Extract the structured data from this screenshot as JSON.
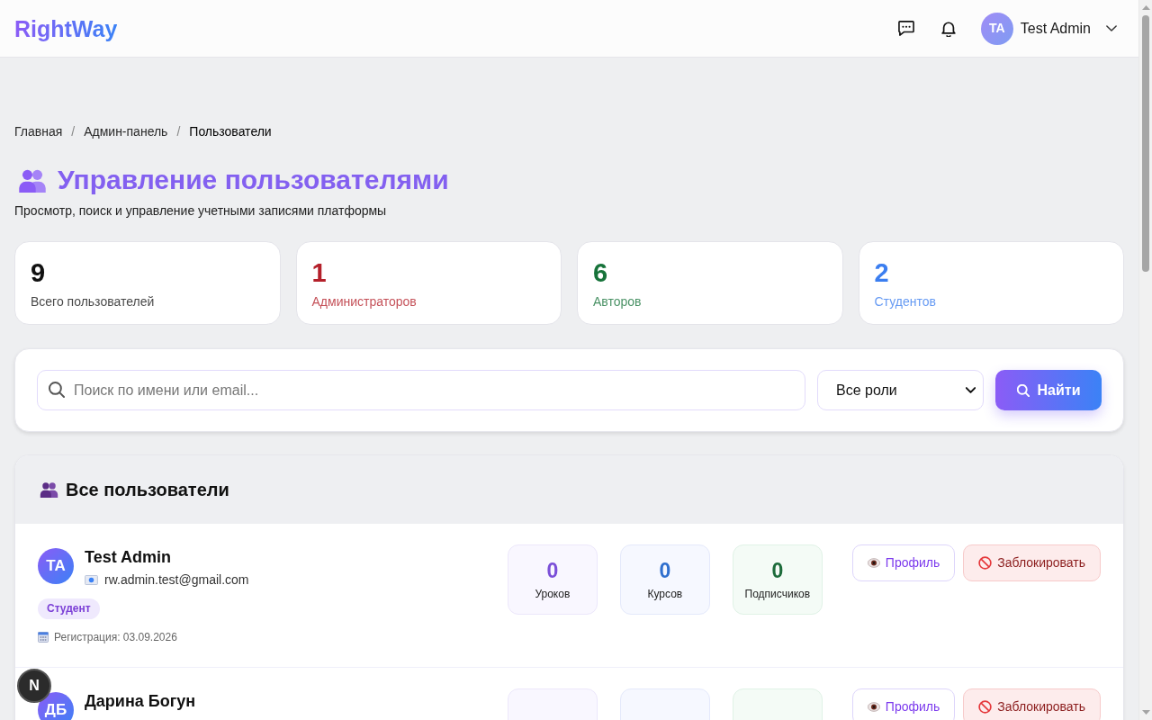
{
  "navbar": {
    "logo": "RightWay",
    "user": {
      "initials": "TA",
      "name": "Test Admin"
    }
  },
  "breadcrumb": [
    {
      "kind": "link",
      "text": "Главная"
    },
    {
      "kind": "separator",
      "text": "/"
    },
    {
      "kind": "link",
      "text": "Админ-панель"
    },
    {
      "kind": "separator",
      "text": "/"
    },
    {
      "kind": "current",
      "text": "Пользователи"
    }
  ],
  "header": {
    "title": "Управление пользователями",
    "subtitle": "Просмотр, поиск и управление учетными записями платформы"
  },
  "stats": [
    {
      "value": "9",
      "label": "Всего пользователей",
      "color": "#111111"
    },
    {
      "value": "1",
      "label": "Администраторов",
      "color": "#b4202a"
    },
    {
      "value": "6",
      "label": "Авторов",
      "color": "#17733a"
    },
    {
      "value": "2",
      "label": "Студентов",
      "color": "#3b7ef0"
    }
  ],
  "filters": {
    "search": {
      "placeholder": "Поиск по имени или email..."
    },
    "role": {
      "value": "Все роли"
    },
    "submit": "Найти"
  },
  "users_panel": {
    "title": "Все пользователи",
    "users": [
      {
        "initials": "TA",
        "name": "Test Admin",
        "email": "rw.admin.test@gmail.com",
        "role": "Студент",
        "registered": "Регистрация: 03.09.2026",
        "stats": [
          {
            "kind": "lessons",
            "value": "0",
            "label": "Уроков"
          },
          {
            "kind": "courses",
            "value": "0",
            "label": "Курсов"
          },
          {
            "kind": "subscribers",
            "value": "0",
            "label": "Подписчиков"
          }
        ],
        "actions": [
          {
            "kind": "profile",
            "label": "Профиль"
          },
          {
            "kind": "block",
            "label": "Заблокировать"
          }
        ]
      },
      {
        "initials": "ДБ",
        "name": "Дарина Богун",
        "stats": [
          {
            "kind": "lessons"
          },
          {
            "kind": "courses"
          },
          {
            "kind": "subscribers"
          }
        ],
        "actions": [
          {
            "kind": "profile",
            "label": "Профиль"
          },
          {
            "kind": "block",
            "label": "Заблокировать"
          }
        ]
      }
    ]
  },
  "dev_badge": "N"
}
